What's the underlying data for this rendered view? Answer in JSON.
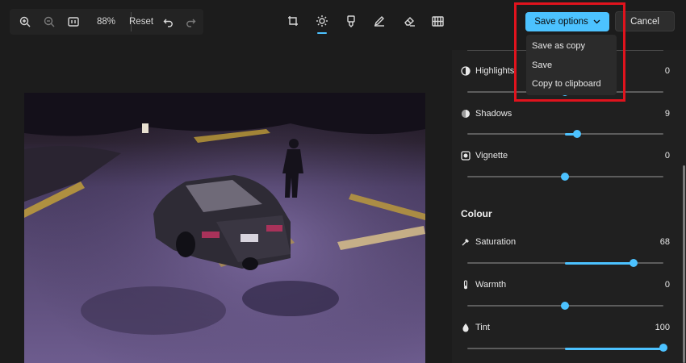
{
  "toolbar": {
    "zoom_level": "88%",
    "reset_label": "Reset"
  },
  "save": {
    "save_options_label": "Save options",
    "cancel_label": "Cancel",
    "menu": [
      {
        "label": "Save as copy"
      },
      {
        "label": "Save"
      },
      {
        "label": "Copy to clipboard"
      }
    ]
  },
  "adjustments": {
    "highlights": {
      "label": "Highlights",
      "value": "0",
      "level": 0
    },
    "shadows": {
      "label": "Shadows",
      "value": "9",
      "level": 9
    },
    "vignette": {
      "label": "Vignette",
      "value": "0",
      "level": 0
    }
  },
  "colour": {
    "title": "Colour",
    "saturation": {
      "label": "Saturation",
      "value": "68",
      "level": 68
    },
    "warmth": {
      "label": "Warmth",
      "value": "0",
      "level": 0
    },
    "tint": {
      "label": "Tint",
      "value": "100",
      "level": 100
    }
  },
  "colors": {
    "accent": "#4cc2ff",
    "highlight_box": "#e0131d",
    "background": "#1c1c1c"
  },
  "icons": [
    "zoom-in-icon",
    "zoom-out-icon",
    "actual-size-icon",
    "undo-icon",
    "redo-icon",
    "crop-icon",
    "adjust-icon",
    "filter-icon",
    "markup-icon",
    "erase-icon",
    "background-icon",
    "chevron-down-icon"
  ]
}
